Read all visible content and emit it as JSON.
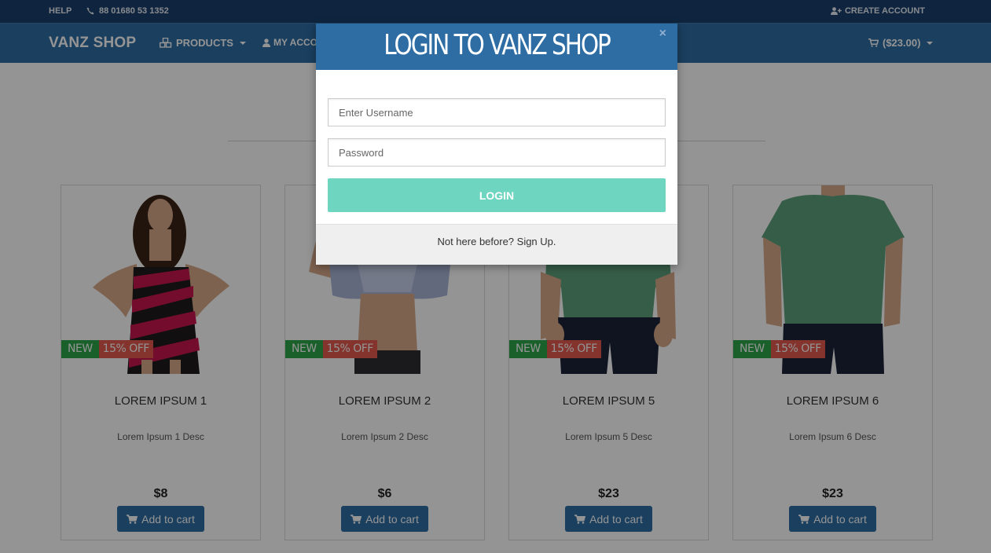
{
  "topbar": {
    "help": "HELP",
    "phone": "88 01680 53 1352",
    "create_account": "CREATE ACCOUNT"
  },
  "navbar": {
    "brand": "VANZ SHOP",
    "products": "PRODUCTS",
    "my_account": "MY ACCO",
    "cart": "($23.00)"
  },
  "products": [
    {
      "name": "LOREM IPSUM 1",
      "desc": "Lorem Ipsum 1 Desc",
      "price": "$8",
      "badge_new": "NEW",
      "badge_off": "15% OFF",
      "cart_label": "Add to cart"
    },
    {
      "name": "LOREM IPSUM 2",
      "desc": "Lorem Ipsum 2 Desc",
      "price": "$6",
      "badge_new": "NEW",
      "badge_off": "15% OFF",
      "cart_label": "Add to cart"
    },
    {
      "name": "LOREM IPSUM 5",
      "desc": "Lorem Ipsum 5 Desc",
      "price": "$23",
      "badge_new": "NEW",
      "badge_off": "15% OFF",
      "cart_label": "Add to cart"
    },
    {
      "name": "LOREM IPSUM 6",
      "desc": "Lorem Ipsum 6 Desc",
      "price": "$23",
      "badge_new": "NEW",
      "badge_off": "15% OFF",
      "cart_label": "Add to cart"
    }
  ],
  "modal": {
    "title": "LOGIN TO VANZ SHOP",
    "close": "×",
    "username_placeholder": "Enter Username",
    "password_placeholder": "Password",
    "login_label": "LOGIN",
    "signup_text": "Not here before? Sign Up."
  },
  "colors": {
    "topbar": "#1b3f6b",
    "navbar": "#2e6da4",
    "login_button": "#6dd5c0",
    "badge_new": "#2ea54a",
    "badge_off": "#e35a4f"
  },
  "icons": {
    "phone": "phone-icon",
    "create_account": "user-plus-icon",
    "products": "cubes-icon",
    "account": "user-icon",
    "cart": "shopping-cart-icon"
  }
}
